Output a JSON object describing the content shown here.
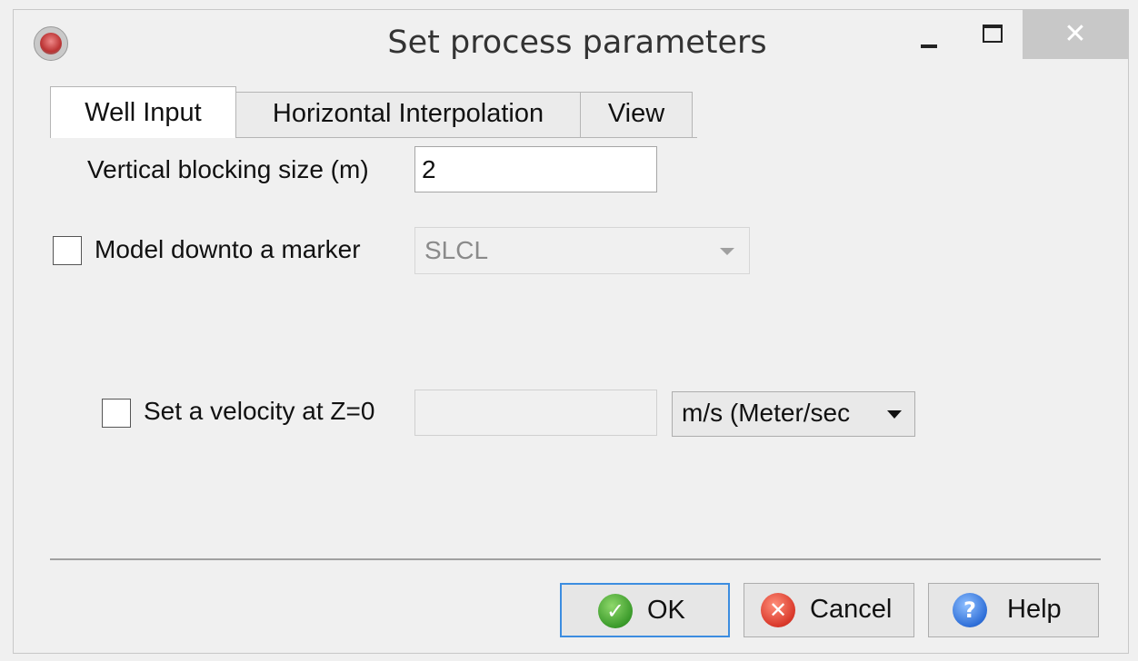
{
  "window": {
    "title": "Set process parameters",
    "close_glyph": "✕"
  },
  "tabs": [
    {
      "label": "Well Input",
      "active": true
    },
    {
      "label": "Horizontal Interpolation",
      "active": false
    },
    {
      "label": "View",
      "active": false
    }
  ],
  "well_input": {
    "vertical_blocking_label": "Vertical blocking size (m)",
    "vertical_blocking_value": "2",
    "model_downto_label": "Model downto a marker",
    "model_downto_checked": false,
    "marker_selected": "SLCL",
    "velocity_label": "Set a velocity at Z=0",
    "velocity_checked": false,
    "velocity_value": "",
    "velocity_unit_selected": "m/s (Meter/sec"
  },
  "buttons": {
    "ok_label": "OK",
    "cancel_label": "Cancel",
    "help_label": "Help"
  },
  "icons": {
    "app": "app-logo-icon",
    "ok": "checkmark-icon",
    "cancel": "x-circle-icon",
    "help": "question-icon"
  }
}
